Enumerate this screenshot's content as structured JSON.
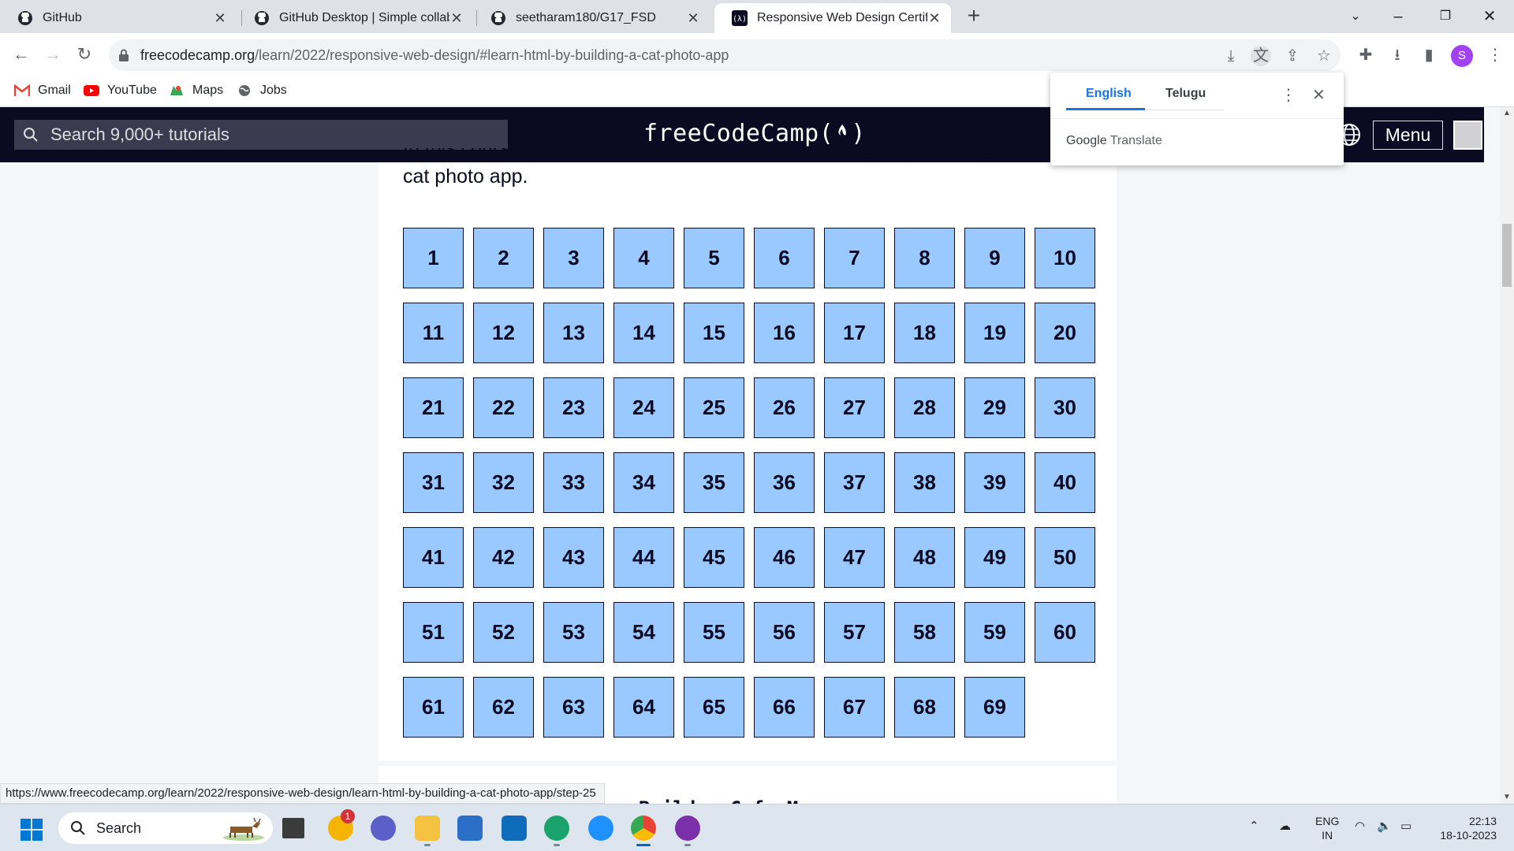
{
  "browser": {
    "tabs": [
      {
        "title": "GitHub",
        "icon": "github-icon",
        "active": false
      },
      {
        "title": "GitHub Desktop | Simple collabo",
        "icon": "github-icon",
        "active": false
      },
      {
        "title": "seetharam180/G17_FSD",
        "icon": "github-icon",
        "active": false
      },
      {
        "title": "Responsive Web Design Certifica",
        "icon": "freecodecamp-icon",
        "active": true
      }
    ],
    "url_host": "freecodecamp.org",
    "url_path": "/learn/2022/responsive-web-design/#learn-html-by-building-a-cat-photo-app",
    "profile_initial": "S",
    "bookmarks": [
      {
        "label": "Gmail",
        "icon": "gmail-icon"
      },
      {
        "label": "YouTube",
        "icon": "youtube-icon"
      },
      {
        "label": "Maps",
        "icon": "maps-icon"
      },
      {
        "label": "Jobs",
        "icon": "globe-icon"
      }
    ],
    "status_url": "https://www.freecodecamp.org/learn/2022/responsive-web-design/learn-html-by-building-a-cat-photo-app/step-25"
  },
  "translate_popup": {
    "lang_source": "English",
    "lang_target": "Telugu",
    "brand_google": "Google",
    "brand_translate": "Translate"
  },
  "fcc": {
    "search_placeholder": "Search 9,000+ tutorials",
    "brand": "freeCodeCamp(",
    "brand_close": ")",
    "menu_label": "Menu",
    "intro_partial": "In this course, you'll learn the most common HTML tags by building your",
    "intro_line2": "cat photo app.",
    "steps": [
      "1",
      "2",
      "3",
      "4",
      "5",
      "6",
      "7",
      "8",
      "9",
      "10",
      "11",
      "12",
      "13",
      "14",
      "15",
      "16",
      "17",
      "18",
      "19",
      "20",
      "21",
      "22",
      "23",
      "24",
      "25",
      "26",
      "27",
      "28",
      "29",
      "30",
      "31",
      "32",
      "33",
      "34",
      "35",
      "36",
      "37",
      "38",
      "39",
      "40",
      "41",
      "42",
      "43",
      "44",
      "45",
      "46",
      "47",
      "48",
      "49",
      "50",
      "51",
      "52",
      "53",
      "54",
      "55",
      "56",
      "57",
      "58",
      "59",
      "60",
      "61",
      "62",
      "63",
      "64",
      "65",
      "66",
      "67",
      "68",
      "69"
    ],
    "next_heading_partial": "Build a Cafe Menu"
  },
  "taskbar": {
    "search_placeholder": "Search",
    "notification_badge": "1",
    "lang_line1": "ENG",
    "lang_line2": "IN",
    "time": "22:13",
    "date": "18-10-2023"
  },
  "colors": {
    "fcc_nav": "#0a0a23",
    "step_fill": "#99c9ff",
    "accent_blue": "#1a73e8"
  }
}
